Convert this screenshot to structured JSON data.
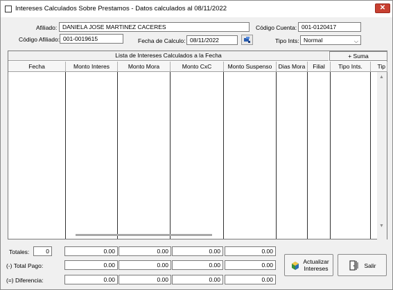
{
  "window": {
    "title": "Intereses Calculados Sobre Prestamos - Datos calculados al 08/11/2022",
    "close_symbol": "✕"
  },
  "form": {
    "afiliado_label": "Afiliado:",
    "afiliado_value": "DANIELA JOSE MARTINEZ CACERES",
    "codigo_cuenta_label": "Código Cuenta:",
    "codigo_cuenta_value": "001-0120417",
    "codigo_afiliado_label": "Código Afiliado:",
    "codigo_afiliado_value": "001-0019615",
    "fecha_calculo_label": "Fecha de Calculo:",
    "fecha_calculo_value": "08/11/2022",
    "tipo_ints_label": "Tipo Ints:",
    "tipo_ints_value": "Normal"
  },
  "grid": {
    "band_title": "Lista de Intereses Calculados a la Fecha",
    "suma_button": "+ Suma",
    "columns": [
      "Fecha",
      "Monto Interes",
      "Monto Mora",
      "Monto CxC",
      "Monto Suspenso",
      "Dias Mora",
      "Filial",
      "Tipo Ints.",
      "Tip"
    ]
  },
  "totals": {
    "totales_label": "Totales:",
    "totales_count": "0",
    "totales_values": [
      "0.00",
      "0.00",
      "0.00",
      "0.00"
    ],
    "total_pago_label": "(-) Total Pago:",
    "total_pago_values": [
      "0.00",
      "0.00",
      "0.00",
      "0.00"
    ],
    "diferencia_label": "(=) Diferencia:",
    "diferencia_values": [
      "0.00",
      "0.00",
      "0.00",
      "0.00"
    ]
  },
  "buttons": {
    "actualizar_line1": "Actualizar",
    "actualizar_line2": "Intereses",
    "salir": "Salir"
  },
  "colors": {
    "close_button": "#c84031",
    "window_bg": "#f0f0f0"
  }
}
